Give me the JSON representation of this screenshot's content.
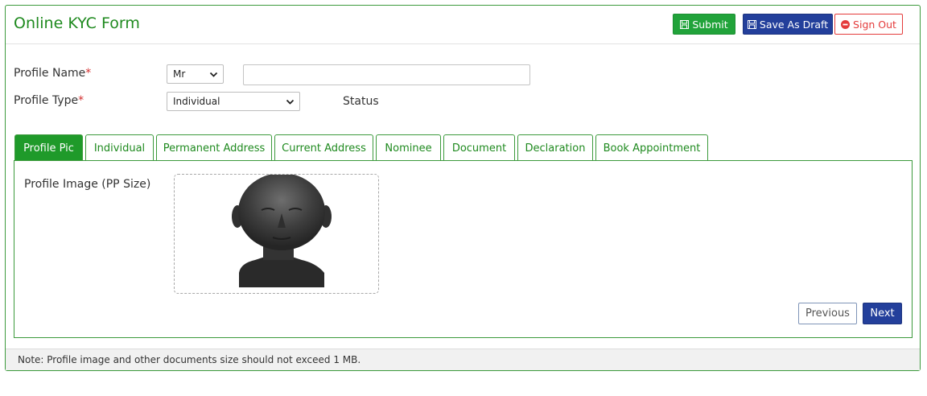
{
  "header": {
    "title": "Online KYC Form",
    "submit_label": "Submit",
    "draft_label": "Save As Draft",
    "signout_label": "Sign Out"
  },
  "form": {
    "profile_name_label": "Profile Name",
    "profile_type_label": "Profile Type",
    "required_mark": "*",
    "salutation_value": "Mr",
    "name_value": "",
    "type_value": "Individual",
    "status_label": "Status"
  },
  "tabs": [
    {
      "label": "Profile Pic",
      "active": true
    },
    {
      "label": "Individual"
    },
    {
      "label": "Permanent Address"
    },
    {
      "label": "Current Address"
    },
    {
      "label": "Nominee"
    },
    {
      "label": "Document"
    },
    {
      "label": "Declaration"
    },
    {
      "label": "Book Appointment"
    }
  ],
  "panel": {
    "image_label": "Profile Image (PP Size)",
    "prev_label": "Previous",
    "next_label": "Next"
  },
  "footer": {
    "note": "Note: Profile image and other documents size should not exceed 1 MB."
  },
  "colors": {
    "accent_green": "#1f9a2a",
    "navy": "#233f9b",
    "danger": "#e43b3b"
  },
  "icons": {
    "submit": "floppy-disk-icon",
    "draft": "floppy-disk-icon",
    "signout": "minus-circle-icon",
    "select": "chevron-down-icon"
  }
}
